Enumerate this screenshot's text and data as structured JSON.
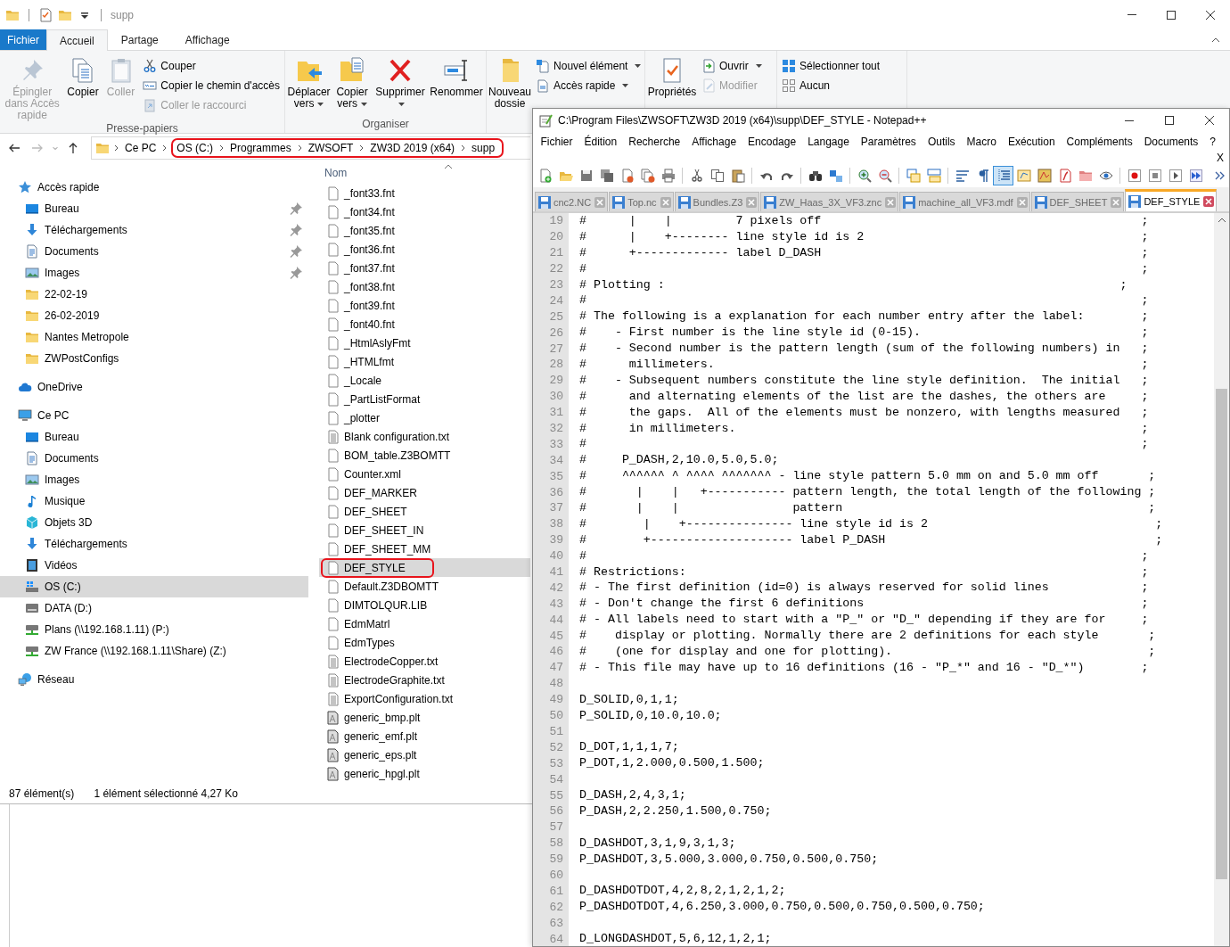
{
  "explorer": {
    "title": "supp",
    "ribbon_tabs": [
      {
        "label": "Fichier",
        "kind": "menu",
        "selected": false
      },
      {
        "label": "Accueil",
        "kind": "tab",
        "selected": true
      },
      {
        "label": "Partage",
        "kind": "tab",
        "selected": false
      },
      {
        "label": "Affichage",
        "kind": "tab",
        "selected": false
      }
    ],
    "ribbon_groups": [
      {
        "label": "Presse-papiers",
        "large": [
          {
            "label": "Épingler dans Accès rapide",
            "disabled": true,
            "dropdown": false
          },
          {
            "label": "Copier",
            "disabled": false,
            "dropdown": false
          },
          {
            "label": "Coller",
            "disabled": true,
            "dropdown": false
          }
        ],
        "small": [
          {
            "label": "Couper",
            "disabled": false,
            "dropdown": false
          },
          {
            "label": "Copier le chemin d'accès",
            "disabled": false,
            "dropdown": false
          },
          {
            "label": "Coller le raccourci",
            "disabled": true,
            "dropdown": false
          }
        ]
      },
      {
        "label": "Organiser",
        "large": [
          {
            "label": "Déplacer vers",
            "disabled": false,
            "dropdown": true
          },
          {
            "label": "Copier vers",
            "disabled": false,
            "dropdown": true
          },
          {
            "label": "Supprimer",
            "disabled": false,
            "dropdown": true
          },
          {
            "label": "Renommer",
            "disabled": false,
            "dropdown": false
          }
        ]
      },
      {
        "large": [
          {
            "label": "Nouveau dossie",
            "disabled": false,
            "dropdown": false
          }
        ],
        "small": [
          {
            "label": "Nouvel élément",
            "disabled": false,
            "dropdown": true
          },
          {
            "label": "Accès rapide",
            "disabled": false,
            "dropdown": true
          }
        ]
      },
      {
        "large": [
          {
            "label": "Propriétés",
            "disabled": false,
            "dropdown": false
          }
        ],
        "small": [
          {
            "label": "Ouvrir",
            "disabled": false,
            "dropdown": true
          },
          {
            "label": "Modifier",
            "disabled": true,
            "dropdown": false
          }
        ]
      },
      {
        "small": [
          {
            "label": "Sélectionner tout",
            "disabled": false,
            "dropdown": false
          },
          {
            "label": "Aucun",
            "disabled": false,
            "dropdown": false
          }
        ]
      }
    ],
    "address": [
      {
        "label": "Ce PC",
        "highlighted": false
      },
      {
        "label": "OS (C:)",
        "highlighted": true
      },
      {
        "label": "Programmes",
        "highlighted": true
      },
      {
        "label": "ZWSOFT",
        "highlighted": true
      },
      {
        "label": "ZW3D 2019 (x64)",
        "highlighted": true
      },
      {
        "label": "supp",
        "highlighted": true
      }
    ],
    "navigation": [
      {
        "label": "Accès rapide",
        "selected": false,
        "children": [
          {
            "label": "Bureau",
            "selected": false,
            "pinned": true
          },
          {
            "label": "Téléchargements",
            "selected": false,
            "pinned": true
          },
          {
            "label": "Documents",
            "selected": false,
            "pinned": true
          },
          {
            "label": "Images",
            "selected": false,
            "pinned": true
          },
          {
            "label": "22-02-19",
            "selected": false,
            "pinned": false
          },
          {
            "label": "26-02-2019",
            "selected": false,
            "pinned": false
          },
          {
            "label": "Nantes Metropole",
            "selected": false,
            "pinned": false
          },
          {
            "label": "ZWPostConfigs",
            "selected": false,
            "pinned": false
          }
        ]
      },
      {
        "label": "OneDrive",
        "selected": false
      },
      {
        "label": "Ce PC",
        "selected": false,
        "children": [
          {
            "label": "Bureau",
            "selected": false
          },
          {
            "label": "Documents",
            "selected": false
          },
          {
            "label": "Images",
            "selected": false
          },
          {
            "label": "Musique",
            "selected": false
          },
          {
            "label": "Objets 3D",
            "selected": false
          },
          {
            "label": "Téléchargements",
            "selected": false
          },
          {
            "label": "Vidéos",
            "selected": false
          },
          {
            "label": "OS (C:)",
            "selected": true
          },
          {
            "label": "DATA (D:)",
            "selected": false
          },
          {
            "label": "Plans (\\\\192.168.1.11) (P:)",
            "selected": false
          },
          {
            "label": "ZW France (\\\\192.168.1.11\\Share) (Z:)",
            "selected": false
          }
        ]
      },
      {
        "label": "Réseau",
        "selected": false
      }
    ],
    "list_header": "Nom",
    "files": [
      {
        "name": "_font33.fnt",
        "kind": "file",
        "selected": false,
        "highlighted": false
      },
      {
        "name": "_font34.fnt",
        "kind": "file",
        "selected": false,
        "highlighted": false
      },
      {
        "name": "_font35.fnt",
        "kind": "file",
        "selected": false,
        "highlighted": false
      },
      {
        "name": "_font36.fnt",
        "kind": "file",
        "selected": false,
        "highlighted": false
      },
      {
        "name": "_font37.fnt",
        "kind": "file",
        "selected": false,
        "highlighted": false
      },
      {
        "name": "_font38.fnt",
        "kind": "file",
        "selected": false,
        "highlighted": false
      },
      {
        "name": "_font39.fnt",
        "kind": "file",
        "selected": false,
        "highlighted": false
      },
      {
        "name": "_font40.fnt",
        "kind": "file",
        "selected": false,
        "highlighted": false
      },
      {
        "name": "_HtmlAslyFmt",
        "kind": "file",
        "selected": false,
        "highlighted": false
      },
      {
        "name": "_HTMLfmt",
        "kind": "file",
        "selected": false,
        "highlighted": false
      },
      {
        "name": "_Locale",
        "kind": "file",
        "selected": false,
        "highlighted": false
      },
      {
        "name": "_PartListFormat",
        "kind": "file",
        "selected": false,
        "highlighted": false
      },
      {
        "name": "_plotter",
        "kind": "file",
        "selected": false,
        "highlighted": false
      },
      {
        "name": "Blank configuration.txt",
        "kind": "text",
        "selected": false,
        "highlighted": false
      },
      {
        "name": "BOM_table.Z3BOMTT",
        "kind": "file",
        "selected": false,
        "highlighted": false
      },
      {
        "name": "Counter.xml",
        "kind": "file",
        "selected": false,
        "highlighted": false
      },
      {
        "name": "DEF_MARKER",
        "kind": "file",
        "selected": false,
        "highlighted": false
      },
      {
        "name": "DEF_SHEET",
        "kind": "file",
        "selected": false,
        "highlighted": false
      },
      {
        "name": "DEF_SHEET_IN",
        "kind": "file",
        "selected": false,
        "highlighted": false
      },
      {
        "name": "DEF_SHEET_MM",
        "kind": "file",
        "selected": false,
        "highlighted": false
      },
      {
        "name": "DEF_STYLE",
        "kind": "file",
        "selected": true,
        "highlighted": true
      },
      {
        "name": "Default.Z3DBOMTT",
        "kind": "file",
        "selected": false,
        "highlighted": false
      },
      {
        "name": "DIMTOLQUR.LIB",
        "kind": "file",
        "selected": false,
        "highlighted": false
      },
      {
        "name": "EdmMatrl",
        "kind": "file",
        "selected": false,
        "highlighted": false
      },
      {
        "name": "EdmTypes",
        "kind": "file",
        "selected": false,
        "highlighted": false
      },
      {
        "name": "ElectrodeCopper.txt",
        "kind": "text",
        "selected": false,
        "highlighted": false
      },
      {
        "name": "ElectrodeGraphite.txt",
        "kind": "text",
        "selected": false,
        "highlighted": false
      },
      {
        "name": "ExportConfiguration.txt",
        "kind": "text",
        "selected": false,
        "highlighted": false
      },
      {
        "name": "generic_bmp.plt",
        "kind": "plot",
        "selected": false,
        "highlighted": false
      },
      {
        "name": "generic_emf.plt",
        "kind": "plot",
        "selected": false,
        "highlighted": false
      },
      {
        "name": "generic_eps.plt",
        "kind": "plot",
        "selected": false,
        "highlighted": false
      },
      {
        "name": "generic_hpgl.plt",
        "kind": "plot",
        "selected": false,
        "highlighted": false
      }
    ],
    "status_bar": [
      "87 élément(s)",
      "1 élément sélectionné  4,27 Ko"
    ]
  },
  "notepad": {
    "title": "C:\\Program Files\\ZWSOFT\\ZW3D 2019 (x64)\\supp\\DEF_STYLE - Notepad++",
    "menu": [
      "Fichier",
      "Édition",
      "Recherche",
      "Affichage",
      "Encodage",
      "Langage",
      "Paramètres",
      "Outils",
      "Macro",
      "Exécution",
      "Compléments",
      "Documents",
      "?"
    ],
    "close_document": "X",
    "toolbar": [
      [
        {
          "pressed": false
        },
        {
          "pressed": false
        },
        {
          "pressed": false
        },
        {
          "pressed": false
        },
        {
          "pressed": false
        },
        {
          "pressed": false
        },
        {
          "pressed": false
        }
      ],
      [
        {
          "pressed": false
        },
        {
          "pressed": false
        },
        {
          "pressed": false
        }
      ],
      [
        {
          "pressed": false
        },
        {
          "pressed": false
        }
      ],
      [
        {
          "pressed": false
        },
        {
          "pressed": false
        }
      ],
      [
        {
          "pressed": false
        },
        {
          "pressed": false
        }
      ],
      [
        {
          "pressed": false
        },
        {
          "pressed": false
        }
      ],
      [
        {
          "pressed": false
        },
        {
          "pressed": false
        },
        {
          "pressed": true
        },
        {
          "pressed": false
        },
        {
          "pressed": false
        },
        {
          "pressed": false
        },
        {
          "pressed": false
        },
        {
          "pressed": false
        }
      ],
      [
        {
          "pressed": false
        },
        {
          "pressed": false
        },
        {
          "pressed": false
        },
        {
          "pressed": false
        }
      ]
    ],
    "tabs": [
      {
        "label": "cnc2.NC",
        "selected": false
      },
      {
        "label": "Top.nc",
        "selected": false
      },
      {
        "label": "Bundles.Z3",
        "selected": false
      },
      {
        "label": "ZW_Haas_3X_VF3.znc",
        "selected": false
      },
      {
        "label": "machine_all_VF3.mdf",
        "selected": false
      },
      {
        "label": "DEF_SHEET",
        "selected": false
      },
      {
        "label": "DEF_STYLE",
        "selected": true
      }
    ],
    "lines": [
      {
        "number": "19",
        "text": "#      |    |         7 pixels off                                             ;"
      },
      {
        "number": "20",
        "text": "#      |    +-------- line style id is 2                                       ;"
      },
      {
        "number": "21",
        "text": "#      +------------- label D_DASH                                             ;"
      },
      {
        "number": "22",
        "text": "#                                                                              ;"
      },
      {
        "number": "23",
        "text": "# Plotting :                                                                ;"
      },
      {
        "number": "24",
        "text": "#                                                                              ;"
      },
      {
        "number": "25",
        "text": "# The following is a explanation for each number entry after the label:        ;"
      },
      {
        "number": "26",
        "text": "#    - First number is the line style id (0-15).                               ;"
      },
      {
        "number": "27",
        "text": "#    - Second number is the pattern length (sum of the following numbers) in   ;"
      },
      {
        "number": "28",
        "text": "#      millimeters.                                                            ;"
      },
      {
        "number": "29",
        "text": "#    - Subsequent numbers constitute the line style definition.  The initial   ;"
      },
      {
        "number": "30",
        "text": "#      and alternating elements of the list are the dashes, the others are     ;"
      },
      {
        "number": "31",
        "text": "#      the gaps.  All of the elements must be nonzero, with lengths measured   ;"
      },
      {
        "number": "32",
        "text": "#      in millimeters.                                                         ;"
      },
      {
        "number": "33",
        "text": "#                                                                              ;"
      },
      {
        "number": "34",
        "text": "#     P_DASH,2,10.0,5.0,5.0;"
      },
      {
        "number": "35",
        "text": "#     ^^^^^^ ^ ^^^^ ^^^^^^^ - line style pattern 5.0 mm on and 5.0 mm off       ;"
      },
      {
        "number": "36",
        "text": "#       |    |   +----------- pattern length, the total length of the following ;"
      },
      {
        "number": "37",
        "text": "#       |    |                pattern                                           ;"
      },
      {
        "number": "38",
        "text": "#        |    +--------------- line style id is 2                                ;"
      },
      {
        "number": "39",
        "text": "#        +-------------------- label P_DASH                                      ;"
      },
      {
        "number": "40",
        "text": "#                                                                              ;"
      },
      {
        "number": "41",
        "text": "# Restrictions:                                                                ;"
      },
      {
        "number": "42",
        "text": "# - The first definition (id=0) is always reserved for solid lines             ;"
      },
      {
        "number": "43",
        "text": "# - Don't change the first 6 definitions                                       ;"
      },
      {
        "number": "44",
        "text": "# - All labels need to start with a \"P_\" or \"D_\" depending if they are for     ;"
      },
      {
        "number": "45",
        "text": "#    display or plotting. Normally there are 2 definitions for each style       ;"
      },
      {
        "number": "46",
        "text": "#    (one for display and one for plotting).                                    ;"
      },
      {
        "number": "47",
        "text": "# - This file may have up to 16 definitions (16 - \"P_*\" and 16 - \"D_*\")        ;"
      },
      {
        "number": "48"
      },
      {
        "number": "49",
        "text": "D_SOLID,0,1,1;"
      },
      {
        "number": "50",
        "text": "P_SOLID,0,10.0,10.0;"
      },
      {
        "number": "51"
      },
      {
        "number": "52",
        "text": "D_DOT,1,1,1,7;"
      },
      {
        "number": "53",
        "text": "P_DOT,1,2.000,0.500,1.500;"
      },
      {
        "number": "54"
      },
      {
        "number": "55",
        "text": "D_DASH,2,4,3,1;"
      },
      {
        "number": "56",
        "text": "P_DASH,2,2.250,1.500,0.750;"
      },
      {
        "number": "57"
      },
      {
        "number": "58",
        "text": "D_DASHDOT,3,1,9,3,1,3;"
      },
      {
        "number": "59",
        "text": "P_DASHDOT,3,5.000,3.000,0.750,0.500,0.750;"
      },
      {
        "number": "60"
      },
      {
        "number": "61",
        "text": "D_DASHDOTDOT,4,2,8,2,1,2,1,2;"
      },
      {
        "number": "62",
        "text": "P_DASHDOTDOT,4,6.250,3.000,0.750,0.500,0.750,0.500,0.750;"
      },
      {
        "number": "63"
      },
      {
        "number": "64",
        "text": "D_LONGDASHDOT,5,6,12,1,2,1;"
      }
    ]
  }
}
